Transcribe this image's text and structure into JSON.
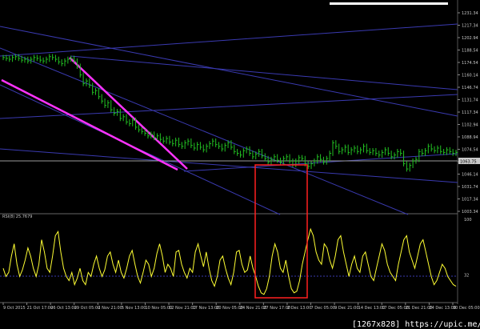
{
  "chart_data": [
    {
      "type": "line",
      "panel": "price",
      "price_label_tag": "1063.75",
      "y_ticks": [
        "1231.34",
        "1217.34",
        "1202.94",
        "1188.54",
        "1174.54",
        "1160.14",
        "1146.74",
        "1131.74",
        "1117.34",
        "1102.94",
        "1088.94",
        "1074.54",
        "1060.14",
        "1046.14",
        "1031.74",
        "1017.34",
        "1003.34"
      ],
      "ylim": [
        1003.34,
        1231.34
      ],
      "series": [
        {
          "values": [
            1180,
            1179,
            1178,
            1180,
            1181,
            1179,
            1177,
            1178,
            1176,
            1178,
            1180,
            1179,
            1177,
            1176,
            1178,
            1181,
            1180,
            1178,
            1175,
            1173,
            1176,
            1178,
            1179,
            1176,
            1170,
            1160,
            1150,
            1153,
            1148,
            1140,
            1142,
            1135,
            1130,
            1125,
            1128,
            1120,
            1116,
            1118,
            1110,
            1112,
            1106,
            1104,
            1108,
            1100,
            1097,
            1095,
            1093,
            1090,
            1092,
            1088,
            1090,
            1086,
            1084,
            1087,
            1083,
            1081,
            1085,
            1080,
            1078,
            1082,
            1084,
            1079,
            1076,
            1080,
            1077,
            1074,
            1078,
            1081,
            1084,
            1080,
            1078,
            1075,
            1079,
            1082,
            1077,
            1072,
            1070,
            1068,
            1073,
            1075,
            1070,
            1066,
            1069,
            1072,
            1067,
            1064,
            1060,
            1063,
            1066,
            1062,
            1060,
            1064,
            1066,
            1061,
            1057,
            1061,
            1065,
            1064,
            1058,
            1055,
            1058,
            1061,
            1066,
            1063,
            1060,
            1064,
            1070,
            1082,
            1078,
            1072,
            1074,
            1077,
            1071,
            1074,
            1076,
            1072,
            1074,
            1078,
            1073,
            1071,
            1073,
            1070,
            1068,
            1071,
            1074,
            1070,
            1066,
            1068,
            1072,
            1070,
            1058,
            1052,
            1056,
            1061,
            1063,
            1072,
            1070,
            1073,
            1078,
            1075,
            1073,
            1076,
            1072,
            1071,
            1074,
            1072,
            1070,
            1071
          ]
        }
      ]
    },
    {
      "type": "line",
      "panel": "indicator",
      "title": "RSI(8) 25.7679",
      "y_ticks": [
        "100",
        "32"
      ],
      "ylim": [
        0,
        100
      ],
      "x_tick_labels": [
        "9 Oct 2015",
        "21 Oct 17:00",
        "26 Oct 13:00",
        "29 Oct 05:00",
        "2 Nov 21:00",
        "5 Nov 13:00",
        "10 Nov 05:00",
        "12 Nov 21:00",
        "17 Nov 13:00",
        "20 Nov 05:00",
        "24 Nov 21:00",
        "27 Nov 17:00",
        "2 Dec 13:00",
        "7 Dec 05:00",
        "9 Dec 21:00",
        "14 Dec 13:00",
        "17 Dec 05:00",
        "21 Dec 21:00",
        "24 Dec 13:00",
        "30 Dec 05:00"
      ],
      "series": [
        {
          "values": [
            40,
            30,
            35,
            55,
            70,
            45,
            30,
            38,
            50,
            65,
            55,
            40,
            30,
            45,
            75,
            60,
            40,
            35,
            55,
            80,
            85,
            60,
            40,
            30,
            25,
            35,
            20,
            28,
            40,
            25,
            20,
            35,
            30,
            45,
            55,
            40,
            30,
            38,
            55,
            60,
            45,
            35,
            50,
            35,
            28,
            40,
            55,
            62,
            45,
            30,
            22,
            35,
            50,
            45,
            30,
            40,
            58,
            70,
            55,
            35,
            45,
            40,
            30,
            60,
            62,
            45,
            35,
            28,
            40,
            35,
            60,
            70,
            55,
            42,
            60,
            40,
            25,
            18,
            30,
            50,
            55,
            40,
            28,
            20,
            35,
            60,
            62,
            45,
            35,
            38,
            55,
            40,
            30,
            18,
            10,
            8,
            15,
            30,
            55,
            70,
            60,
            40,
            35,
            50,
            30,
            15,
            10,
            12,
            25,
            45,
            60,
            75,
            88,
            80,
            60,
            50,
            45,
            70,
            65,
            50,
            40,
            55,
            75,
            80,
            60,
            45,
            30,
            45,
            55,
            40,
            35,
            55,
            60,
            45,
            30,
            25,
            40,
            55,
            70,
            62,
            45,
            35,
            30,
            25,
            45,
            60,
            75,
            80,
            60,
            50,
            40,
            55,
            70,
            75,
            60,
            45,
            30,
            20,
            25,
            35,
            45,
            40,
            30,
            25,
            20,
            18
          ]
        }
      ]
    }
  ],
  "watermark": "[1267x828] https://upic.me/"
}
